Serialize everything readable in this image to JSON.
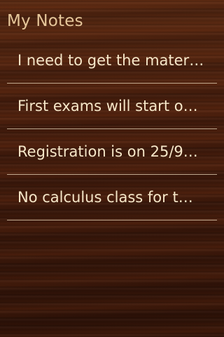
{
  "app": {
    "title": "My Notes"
  },
  "notes": [
    {
      "text": "I need to get the mater…"
    },
    {
      "text": "First exams will start o…"
    },
    {
      "text": "Registration is on 25/9…"
    },
    {
      "text": "No calculus class for t…"
    }
  ]
}
